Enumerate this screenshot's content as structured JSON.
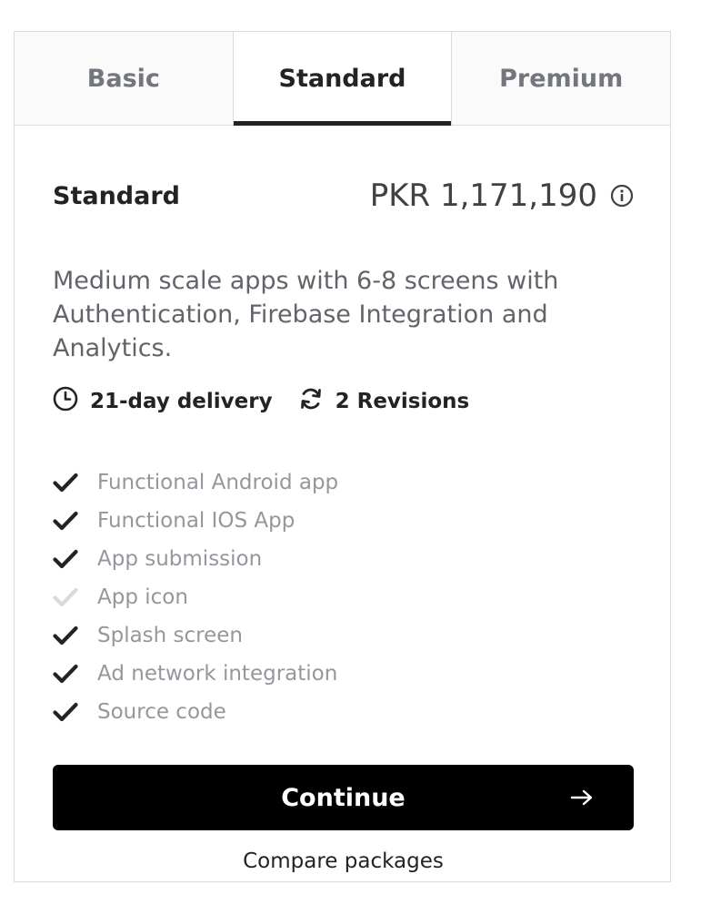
{
  "tabs": [
    {
      "label": "Basic",
      "active": false
    },
    {
      "label": "Standard",
      "active": true
    },
    {
      "label": "Premium",
      "active": false
    }
  ],
  "package": {
    "title": "Standard",
    "price": "PKR 1,171,190",
    "description": "Medium scale apps with 6-8 screens with Authentication, Firebase Integration and Analytics.",
    "delivery": "21-day delivery",
    "revisions": "2 Revisions"
  },
  "features": [
    {
      "label": "Functional Android app",
      "included": true
    },
    {
      "label": "Functional IOS App",
      "included": true
    },
    {
      "label": "App submission",
      "included": true
    },
    {
      "label": "App icon",
      "included": false
    },
    {
      "label": "Splash screen",
      "included": true
    },
    {
      "label": "Ad network integration",
      "included": true
    },
    {
      "label": "Source code",
      "included": true
    }
  ],
  "actions": {
    "continue_label": "Continue",
    "compare_label": "Compare packages"
  },
  "colors": {
    "check_included": "#222325",
    "check_excluded": "#dadbdd",
    "button_bg": "#000000"
  }
}
